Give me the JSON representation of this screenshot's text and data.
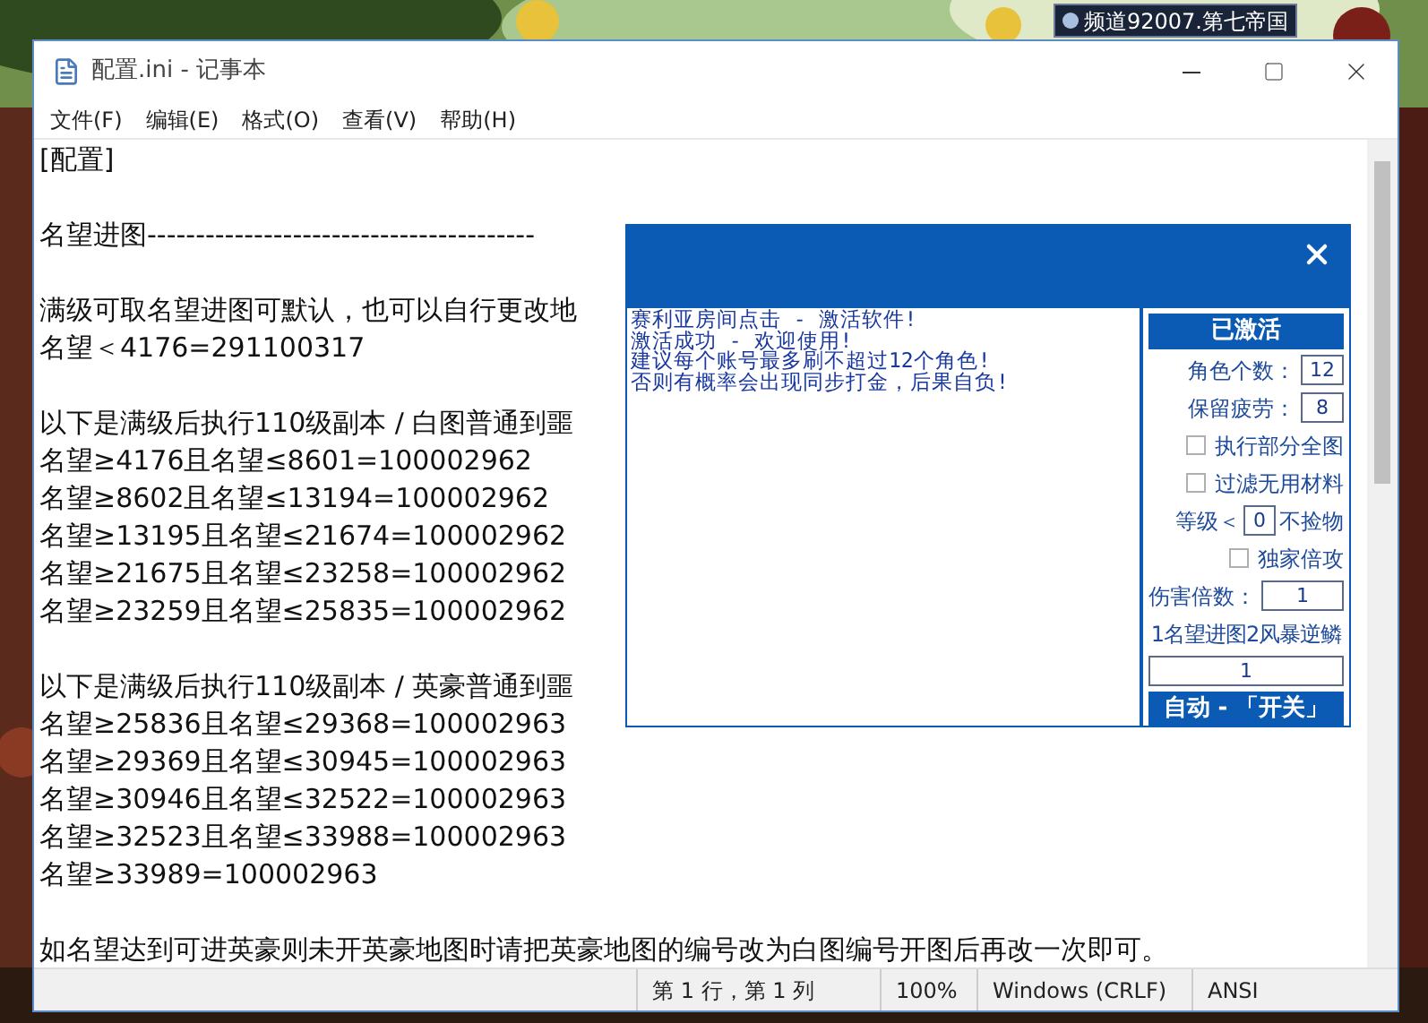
{
  "game": {
    "channel": "频道92007.第七帝国"
  },
  "notepad": {
    "title": "配置.ini - 记事本",
    "menu": [
      "文件(F)",
      "编辑(E)",
      "格式(O)",
      "查看(V)",
      "帮助(H)"
    ],
    "paragraphs": [
      [
        "[配置]"
      ],
      [
        "名望进图----------------------------------------"
      ],
      [
        "满级可取名望进图可默认，也可以自行更改地",
        "名望＜4176=291100317"
      ],
      [
        "以下是满级后执行110级副本 / 白图普通到噩",
        "名望≥4176且名望≤8601=100002962",
        "名望≥8602且名望≤13194=100002962",
        "名望≥13195且名望≤21674=100002962",
        "名望≥21675且名望≤23258=100002962",
        "名望≥23259且名望≤25835=100002962"
      ],
      [
        "以下是满级后执行110级副本 / 英豪普通到噩",
        "名望≥25836且名望≤29368=100002963",
        "名望≥29369且名望≤30945=100002963",
        "名望≥30946且名望≤32522=100002963",
        "名望≥32523且名望≤33988=100002963",
        "名望≥33989=100002963"
      ],
      [
        "如名望达到可进英豪则未开英豪地图时请把英豪地图的编号改为白图编号开图后再改一次即可。"
      ]
    ],
    "status": [
      "第 1 行，第 1 列",
      "100%",
      "Windows (CRLF)",
      "ANSI"
    ]
  },
  "dialog": {
    "log": [
      "赛利亚房间点击 - 激活软件!",
      "激活成功 - 欢迎使用!",
      "建议每个账号最多刷不超过12个角色!",
      "否则有概率会出现同步打金，后果自负!"
    ],
    "activate_button": "已激活",
    "controls": [
      {
        "kind": "input",
        "label": "角色个数：",
        "value": "12"
      },
      {
        "kind": "input",
        "label": "保留疲劳：",
        "value": "8"
      },
      {
        "kind": "checkbox",
        "label": "执行部分全图",
        "checked": false
      },
      {
        "kind": "checkbox",
        "label": "过滤无用材料",
        "checked": false
      },
      {
        "kind": "inline",
        "before": "等级＜",
        "value": "0",
        "after": "不捡物"
      },
      {
        "kind": "checkbox",
        "label": "独家倍攻",
        "checked": false
      },
      {
        "kind": "wideinput",
        "label": "伤害倍数：",
        "value": "1"
      },
      {
        "kind": "label",
        "label": "1名望进图2风暴逆鳞"
      },
      {
        "kind": "full",
        "value": "1"
      }
    ],
    "auto_button": "自动 - 「开关」"
  }
}
